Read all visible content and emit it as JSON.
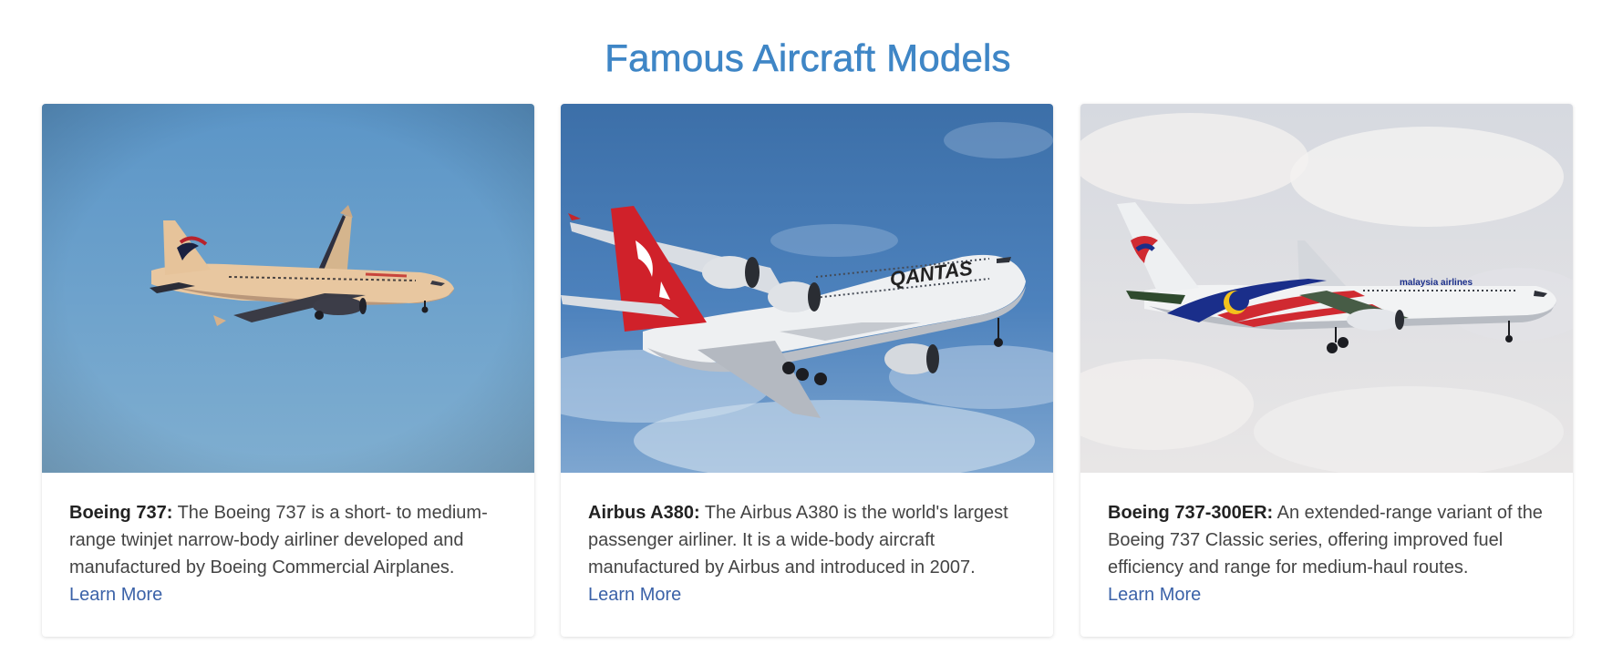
{
  "page": {
    "title": "Famous Aircraft Models"
  },
  "cards": [
    {
      "name": "Boeing 737:",
      "description": "The Boeing 737 is a short- to medium-range twinjet narrow-body airliner developed and manufactured by Boeing Commercial Airplanes.",
      "link_label": "Learn More",
      "image_icon": "airplane-photo"
    },
    {
      "name": "Airbus A380:",
      "description": "The Airbus A380 is the world's largest passenger airliner. It is a wide-body aircraft manufactured by Airbus and introduced in 2007.",
      "link_label": "Learn More",
      "image_icon": "airplane-photo"
    },
    {
      "name": "Boeing 737-300ER:",
      "description": "An extended-range variant of the Boeing 737 Classic series, offering improved fuel efficiency and range for medium-haul routes.",
      "link_label": "Learn More",
      "image_icon": "airplane-photo"
    }
  ],
  "colors": {
    "title": "#3f86c6",
    "link": "#3b62a8",
    "text": "#444444"
  }
}
